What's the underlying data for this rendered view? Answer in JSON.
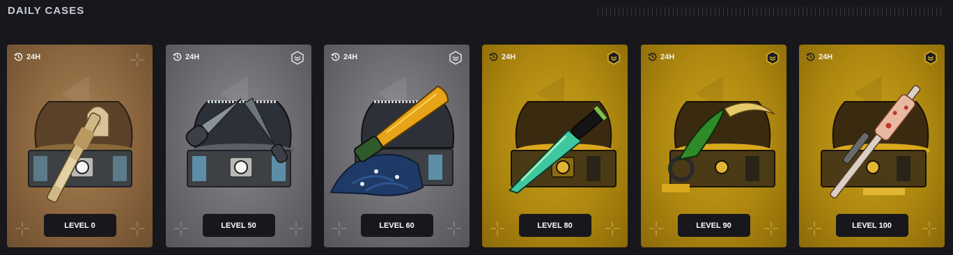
{
  "section": {
    "title": "DAILY CASES"
  },
  "cards": [
    {
      "timer": "24H",
      "level_label": "LEVEL 0",
      "tier": "bronze",
      "badge": "none",
      "item": "ornate-rifle-icon"
    },
    {
      "timer": "24H",
      "level_label": "LEVEL 50",
      "tier": "silver",
      "badge": "outline",
      "item": "steel-knives-icon"
    },
    {
      "timer": "24H",
      "level_label": "LEVEL 60",
      "tier": "silver",
      "badge": "outline",
      "item": "gold-blade-icon"
    },
    {
      "timer": "24H",
      "level_label": "LEVEL 80",
      "tier": "gold",
      "badge": "filled",
      "item": "fade-bowie-knife-icon"
    },
    {
      "timer": "24H",
      "level_label": "LEVEL 90",
      "tier": "gold",
      "badge": "filled",
      "item": "karambit-knife-icon"
    },
    {
      "timer": "24H",
      "level_label": "LEVEL 100",
      "tier": "gold",
      "badge": "filled",
      "item": "awp-sniper-rifle-icon"
    }
  ],
  "colors": {
    "page_background": "#17171c",
    "title": "#c9cdd8",
    "bronze": "#8a653e",
    "silver": "#6b6b70",
    "gold": "#ad870f",
    "button": "#17171c"
  }
}
